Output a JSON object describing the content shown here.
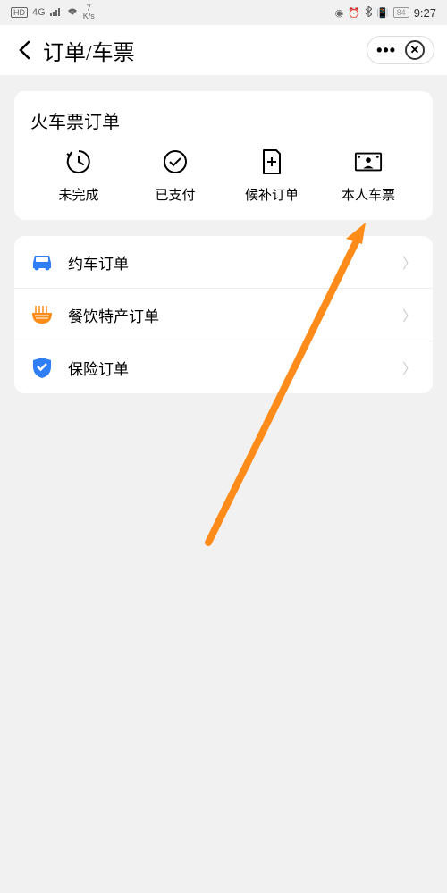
{
  "statusbar": {
    "hd": "HD",
    "net": "4G",
    "speed_num": "7",
    "speed_unit": "K/s",
    "battery": "84",
    "time": "9:27"
  },
  "header": {
    "title": "订单/车票"
  },
  "card": {
    "title": "火车票订单",
    "actions": [
      {
        "label": "未完成"
      },
      {
        "label": "已支付"
      },
      {
        "label": "候补订单"
      },
      {
        "label": "本人车票"
      }
    ]
  },
  "list": [
    {
      "label": "约车订单",
      "color": "#2f7ef5"
    },
    {
      "label": "餐饮特产订单",
      "color": "#ff8c1a"
    },
    {
      "label": "保险订单",
      "color": "#2f7ef5"
    }
  ]
}
